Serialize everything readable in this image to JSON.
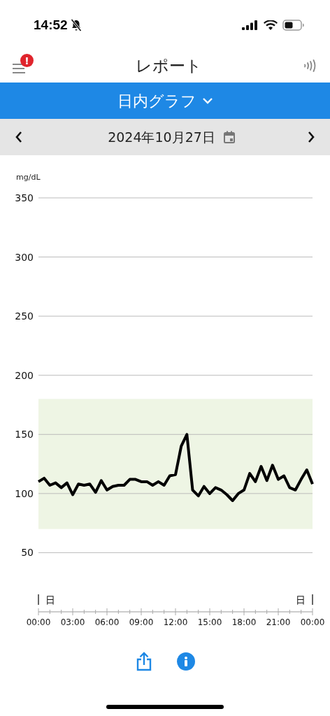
{
  "status_bar": {
    "time": "14:52"
  },
  "header": {
    "title": "レポート",
    "alert_badge": "!"
  },
  "view_selector": {
    "label": "日内グラフ"
  },
  "date_bar": {
    "date": "2024年10月27日"
  },
  "chart": {
    "unit": "mg/dL",
    "day_markers": [
      "日",
      "日"
    ],
    "chart_data": {
      "type": "line",
      "x": [
        0,
        0.5,
        1,
        1.5,
        2,
        2.5,
        3,
        3.5,
        4,
        4.5,
        5,
        5.5,
        6,
        6.5,
        7,
        7.5,
        8,
        8.5,
        9,
        9.5,
        10,
        10.5,
        11,
        11.5,
        12,
        12.5,
        13,
        13.5,
        14,
        14.5,
        15,
        15.5,
        16,
        16.5,
        17,
        17.5,
        18,
        18.5,
        19,
        19.5,
        20,
        20.5,
        21,
        21.5,
        22,
        22.5,
        23,
        23.5,
        24
      ],
      "series": [
        {
          "color": "#000000",
          "values": [
            110,
            113,
            107,
            109,
            105,
            109,
            99,
            108,
            107,
            108,
            101,
            111,
            103,
            106,
            107,
            107,
            112,
            112,
            110,
            110,
            107,
            110,
            107,
            115,
            116,
            140,
            150,
            103,
            98,
            106,
            100,
            105,
            103,
            99,
            94,
            100,
            103,
            117,
            110,
            123,
            111,
            124,
            112,
            115,
            105,
            103,
            112,
            120,
            108
          ]
        }
      ],
      "xlim": [
        0,
        24
      ],
      "ylim": [
        0,
        350
      ],
      "xticks": [
        {
          "value": 0,
          "label": "00:00"
        },
        {
          "value": 3,
          "label": "03:00"
        },
        {
          "value": 6,
          "label": "06:00"
        },
        {
          "value": 9,
          "label": "09:00"
        },
        {
          "value": 12,
          "label": "12:00"
        },
        {
          "value": 15,
          "label": "15:00"
        },
        {
          "value": 18,
          "label": "18:00"
        },
        {
          "value": 21,
          "label": "21:00"
        },
        {
          "value": 24,
          "label": "00:00"
        }
      ],
      "yticks": [
        50,
        100,
        150,
        200,
        250,
        300,
        350
      ],
      "grid": true,
      "bands": [
        {
          "axis": "y",
          "from": 70,
          "to": 180,
          "color": "#eef5e4"
        }
      ]
    }
  }
}
